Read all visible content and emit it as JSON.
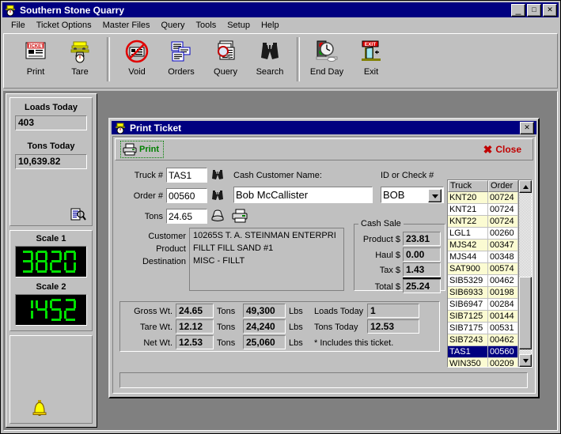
{
  "window": {
    "title": "Southern Stone Quarry",
    "icon": "quarry-truck-icon",
    "minimize_label": "_",
    "maximize_label": "□",
    "close_label": "✕"
  },
  "menu": [
    {
      "label": "File",
      "accel": "F"
    },
    {
      "label": "Ticket Options",
      "accel": "T"
    },
    {
      "label": "Master Files",
      "accel": "M"
    },
    {
      "label": "Query",
      "accel": "Q"
    },
    {
      "label": "Tools",
      "accel": "o"
    },
    {
      "label": "Setup",
      "accel": "S"
    },
    {
      "label": "Help",
      "accel": "H"
    }
  ],
  "toolbar": {
    "buttons": [
      {
        "label": "Print",
        "icon": "ticket-print-icon"
      },
      {
        "label": "Tare",
        "icon": "truck-on-scale-icon"
      },
      {
        "label": "Void",
        "icon": "void-circle-slash-icon"
      },
      {
        "label": "Orders",
        "icon": "documents-stack-icon"
      },
      {
        "label": "Query",
        "icon": "magnifier-document-icon"
      },
      {
        "label": "Search",
        "icon": "binoculars-icon"
      },
      {
        "label": "End Day",
        "icon": "traffic-light-clock-icon"
      },
      {
        "label": "Exit",
        "icon": "exit-door-icon"
      }
    ]
  },
  "sidebar": {
    "loads_today_label": "Loads Today",
    "loads_today_value": "403",
    "tons_today_label": "Tons Today",
    "tons_today_value": "10,639.82",
    "report_icon": "report-magnifier-icon",
    "scale1_label": "Scale 1",
    "scale1_value": "3820",
    "scale2_label": "Scale 2",
    "scale2_value": "1452",
    "bell_icon": "bell-icon"
  },
  "dialog": {
    "title": "Print Ticket",
    "icon": "quarry-truck-icon",
    "close_box_label": "✕",
    "print_button": "Print",
    "print_icon": "printer-icon",
    "close_button": "Close",
    "close_icon": "red-x-icon",
    "fields": {
      "truck_label": "Truck #",
      "truck_value": "TAS1",
      "truck_lookup_icon": "binoculars-icon",
      "order_label": "Order #",
      "order_value": "00560",
      "order_lookup_icon": "binoculars-icon",
      "tons_label": "Tons",
      "tons_value": "24.65",
      "tons_stack_icon": "material-pile-icon",
      "tons_print_icon": "printer-icon",
      "cash_customer_label": "Cash Customer Name:",
      "cash_customer_value": "Bob McCallister",
      "id_check_label": "ID or Check #",
      "id_check_value": "BOB",
      "id_check_arrow_icon": "chevron-down-icon"
    },
    "info": {
      "customer_label": "Customer",
      "customer_value": "10265S  T. A. STEINMAN ENTERPRI",
      "product_label": "Product",
      "product_value": "FILLT     FILL SAND #1",
      "destination_label": "Destination",
      "destination_value": "MISC - FILLT"
    },
    "cash_sale": {
      "title": "Cash Sale",
      "product_label": "Product $",
      "product_value": "23.81",
      "haul_label": "Haul $",
      "haul_value": "0.00",
      "tax_label": "Tax $",
      "tax_value": "1.43",
      "total_label": "Total $",
      "total_value": "25.24"
    },
    "weights": {
      "gross_label": "Gross Wt.",
      "gross_tons": "24.65",
      "gross_lbs": "49,300",
      "tare_label": "Tare Wt.",
      "tare_tons": "12.12",
      "tare_lbs": "24,240",
      "net_label": "Net Wt.",
      "net_tons": "12.53",
      "net_lbs": "25,060",
      "tons_unit": "Tons",
      "lbs_unit": "Lbs",
      "loads_today_label": "Loads Today",
      "loads_today_value": "1",
      "tons_today_label": "Tons Today",
      "tons_today_value": "12.53",
      "footnote": "*  Includes this ticket."
    },
    "grid": {
      "columns": [
        "Truck",
        "Order"
      ],
      "rows": [
        {
          "truck": "KNT20",
          "order": "00724",
          "selected": false
        },
        {
          "truck": "KNT21",
          "order": "00724",
          "selected": false
        },
        {
          "truck": "KNT22",
          "order": "00724",
          "selected": false
        },
        {
          "truck": "LGL1",
          "order": "00260",
          "selected": false
        },
        {
          "truck": "MJS42",
          "order": "00347",
          "selected": false
        },
        {
          "truck": "MJS44",
          "order": "00348",
          "selected": false
        },
        {
          "truck": "SAT900",
          "order": "00574",
          "selected": false
        },
        {
          "truck": "SIB5329",
          "order": "00462",
          "selected": false
        },
        {
          "truck": "SIB6933",
          "order": "00198",
          "selected": false
        },
        {
          "truck": "SIB6947",
          "order": "00284",
          "selected": false
        },
        {
          "truck": "SIB7125",
          "order": "00144",
          "selected": false
        },
        {
          "truck": "SIB7175",
          "order": "00531",
          "selected": false
        },
        {
          "truck": "SIB7243",
          "order": "00462",
          "selected": false
        },
        {
          "truck": "TAS1",
          "order": "00560",
          "selected": true
        },
        {
          "truck": "WIN350",
          "order": "00209",
          "selected": false
        }
      ],
      "scroll_up_icon": "triangle-up-icon",
      "scroll_down_icon": "triangle-down-icon"
    }
  },
  "colors": {
    "titlebar": "#000080",
    "face": "#c0c0c0",
    "led_green": "#00d800",
    "accent_green": "#008000",
    "accent_red": "#c00000",
    "row_alt": "#fbfbd2"
  }
}
